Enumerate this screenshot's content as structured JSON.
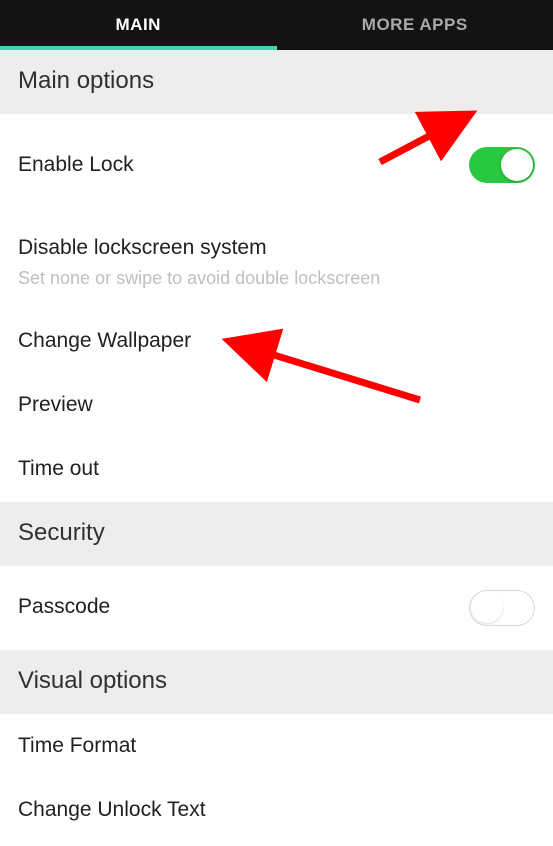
{
  "tabs": {
    "main": "MAIN",
    "more_apps": "MORE APPS"
  },
  "sections": {
    "main_options": {
      "header": "Main options"
    },
    "security": {
      "header": "Security"
    },
    "visual_options": {
      "header": "Visual options"
    }
  },
  "rows": {
    "enable_lock": {
      "title": "Enable Lock",
      "toggle_on": true
    },
    "disable_lockscreen": {
      "title": "Disable lockscreen system",
      "subtitle": "Set none or swipe to avoid double lockscreen"
    },
    "change_wallpaper": {
      "title": "Change Wallpaper"
    },
    "preview": {
      "title": "Preview"
    },
    "time_out": {
      "title": "Time out"
    },
    "passcode": {
      "title": "Passcode",
      "toggle_on": false
    },
    "time_format": {
      "title": "Time Format"
    },
    "change_unlock_text": {
      "title": "Change Unlock Text"
    }
  },
  "annotations": {
    "arrow_color": "#ff0000"
  }
}
